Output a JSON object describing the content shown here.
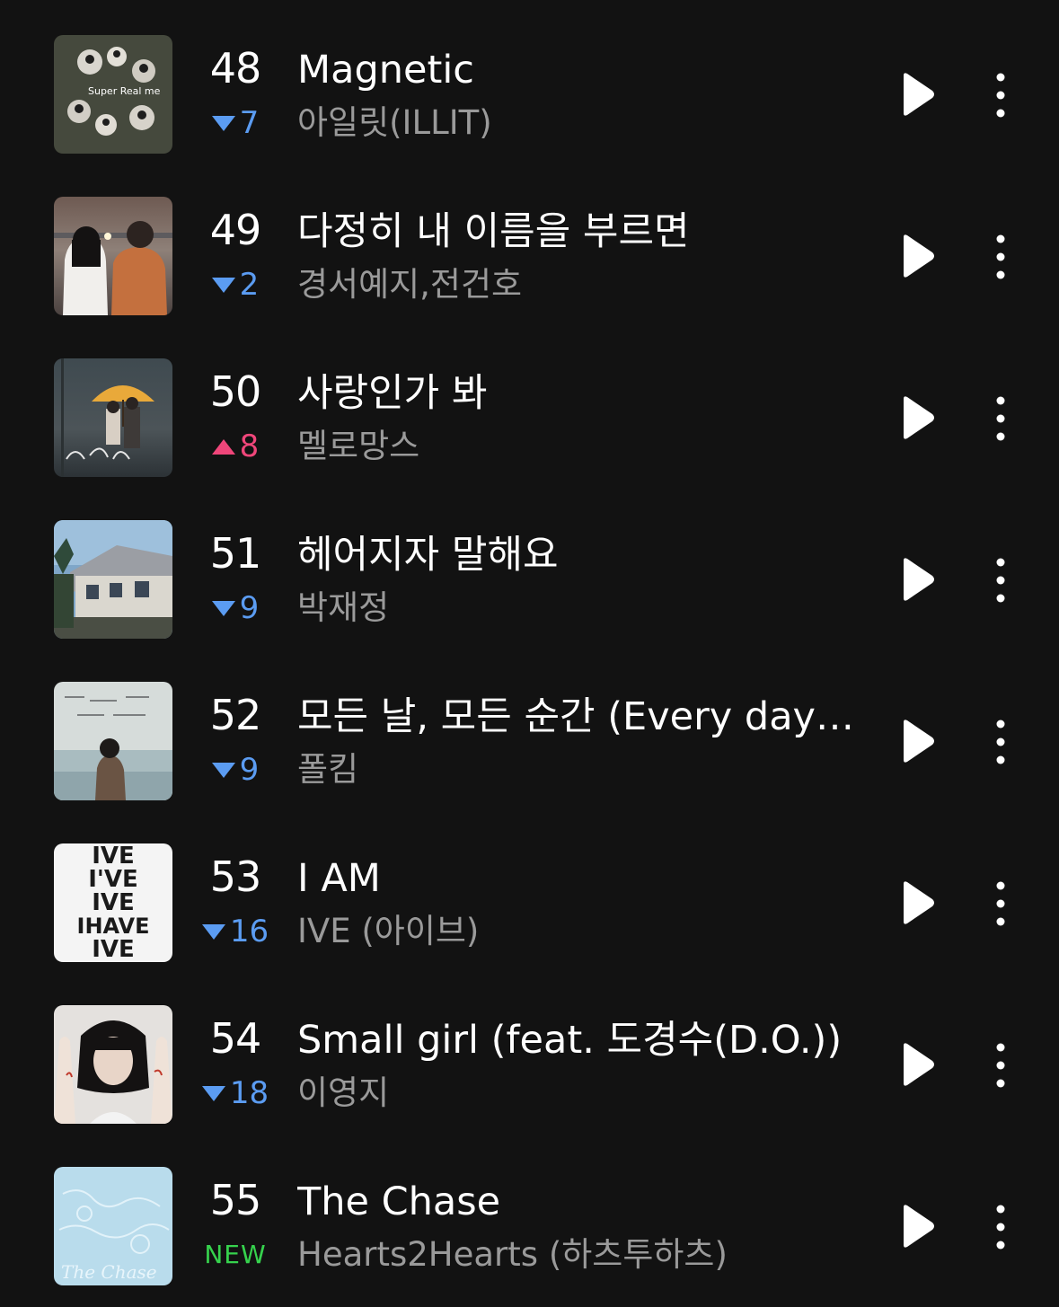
{
  "chart": {
    "rows": [
      {
        "rank": "48",
        "change": "7",
        "direction": "down",
        "title": "Magnetic",
        "artist": "아일릿(ILLIT)",
        "art_icon": "album-art-illit-super-real-me"
      },
      {
        "rank": "49",
        "change": "2",
        "direction": "down",
        "title": "다정히 내 이름을 부르면",
        "artist": "경서예지,전건호",
        "art_icon": "album-art-couple-sparkler"
      },
      {
        "rank": "50",
        "change": "8",
        "direction": "up",
        "title": "사랑인가 봐",
        "artist": "멜로망스",
        "art_icon": "album-art-umbrella-rain"
      },
      {
        "rank": "51",
        "change": "9",
        "direction": "down",
        "title": "헤어지자 말해요",
        "artist": "박재정",
        "art_icon": "album-art-house"
      },
      {
        "rank": "52",
        "change": "9",
        "direction": "down",
        "title": "모든 날, 모든 순간 (Every day, Every Moment)",
        "artist": "폴킴",
        "art_icon": "album-art-seaside"
      },
      {
        "rank": "53",
        "change": "16",
        "direction": "down",
        "title": "I AM",
        "artist": "IVE (아이브)",
        "art_icon": "album-art-ive-text"
      },
      {
        "rank": "54",
        "change": "18",
        "direction": "down",
        "title": "Small girl (feat. 도경수(D.O.))",
        "artist": "이영지",
        "art_icon": "album-art-portrait-hands"
      },
      {
        "rank": "55",
        "change": "NEW",
        "direction": "new",
        "title": "The Chase",
        "artist": "Hearts2Hearts (하츠투하츠)",
        "art_icon": "album-art-light-blue"
      }
    ]
  },
  "album_art_text": {
    "ive": [
      "IVE",
      "I'VE",
      "IVE",
      "IHAVE",
      "IVE"
    ],
    "chase": "The Chase",
    "illit": "Super Real me"
  },
  "colors": {
    "background": "#121212",
    "rank": "#ffffff",
    "title": "#ffffff",
    "artist": "#9a9a9a",
    "rank_down": "#5b9cf2",
    "rank_up": "#f0467a",
    "rank_new": "#36d24d"
  },
  "icons": {
    "play": "play-icon",
    "more": "more-vertical-icon",
    "down": "triangle-down-icon",
    "up": "triangle-up-icon"
  }
}
